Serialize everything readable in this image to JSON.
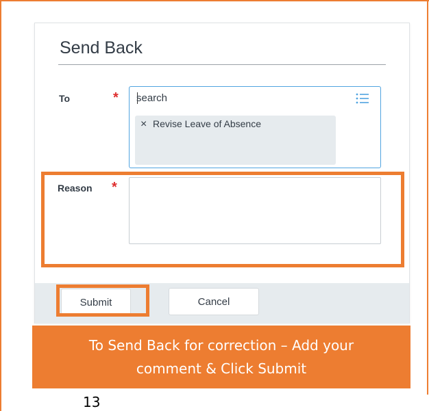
{
  "dialog": {
    "title": "Send Back",
    "to_field": {
      "label": "To",
      "required_mark": "*",
      "search_placeholder": "search",
      "selected": [
        {
          "label": "Revise Leave of Absence",
          "remove_glyph": "×"
        }
      ],
      "list_icon": "list-icon"
    },
    "reason_field": {
      "label": "Reason",
      "required_mark": "*",
      "value": ""
    },
    "buttons": {
      "submit": "Submit",
      "cancel": "Cancel"
    }
  },
  "caption": {
    "line1": "To Send Back for correction – Add your",
    "line2": "comment & Click Submit"
  },
  "page_number": "13",
  "colors": {
    "annotation_orange": "#ed7d31",
    "required_red": "#de2f2f",
    "focus_blue": "#4fa3e0",
    "footer_gray": "#e6ebee",
    "text_dark": "#333c46"
  }
}
